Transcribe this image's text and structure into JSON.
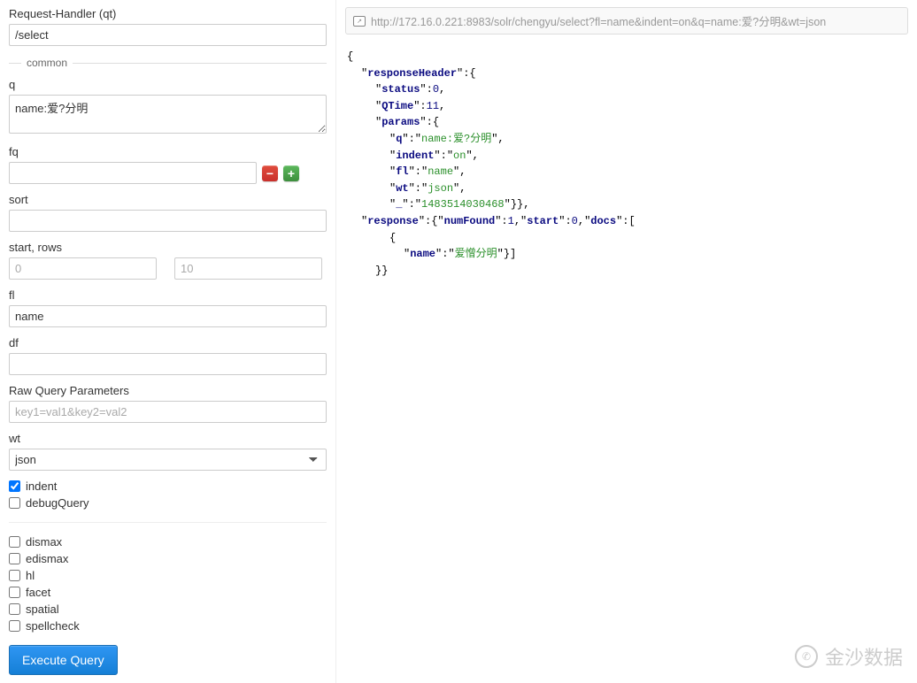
{
  "form": {
    "qt_label": "Request-Handler (qt)",
    "qt_value": "/select",
    "common_legend": "common",
    "q_label": "q",
    "q_value": "name:爱?分明",
    "fq_label": "fq",
    "fq_value": "",
    "sort_label": "sort",
    "sort_value": "",
    "start_rows_label": "start, rows",
    "start_value": "",
    "start_placeholder": "0",
    "rows_value": "",
    "rows_placeholder": "10",
    "fl_label": "fl",
    "fl_value": "name",
    "df_label": "df",
    "df_value": "",
    "raw_label": "Raw Query Parameters",
    "raw_placeholder": "key1=val1&key2=val2",
    "raw_value": "",
    "wt_label": "wt",
    "wt_value": "json",
    "indent_label": "indent",
    "indent_checked": true,
    "debug_label": "debugQuery",
    "debug_checked": false,
    "dismax_label": "dismax",
    "edismax_label": "edismax",
    "hl_label": "hl",
    "facet_label": "facet",
    "spatial_label": "spatial",
    "spellcheck_label": "spellcheck",
    "execute_label": "Execute Query"
  },
  "result": {
    "url": "http://172.16.0.221:8983/solr/chengyu/select?fl=name&indent=on&q=name:爱?分明&wt=json",
    "responseHeader_key": "responseHeader",
    "status_key": "status",
    "status_val": "0",
    "qtime_key": "QTime",
    "qtime_val": "11",
    "params_key": "params",
    "p_q_key": "q",
    "p_q_val": "name:爱?分明",
    "p_indent_key": "indent",
    "p_indent_val": "on",
    "p_fl_key": "fl",
    "p_fl_val": "name",
    "p_wt_key": "wt",
    "p_wt_val": "json",
    "p_ts_key": "_",
    "p_ts_val": "1483514030468",
    "response_key": "response",
    "numFound_key": "numFound",
    "numFound_val": "1",
    "start_key": "start",
    "start_val": "0",
    "docs_key": "docs",
    "doc_name_key": "name",
    "doc_name_val": "爱憎分明"
  },
  "watermark": {
    "text": "金沙数据"
  }
}
